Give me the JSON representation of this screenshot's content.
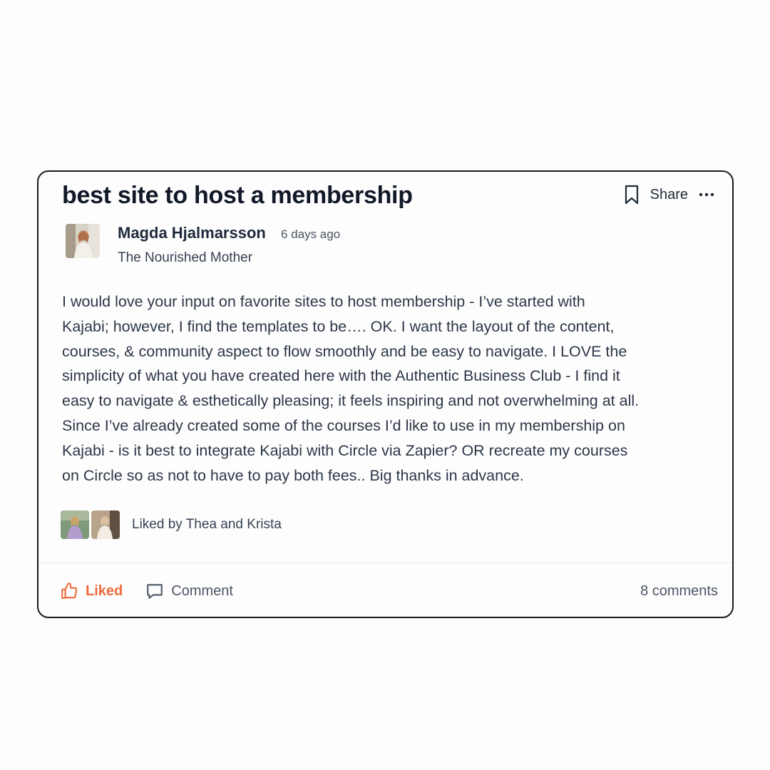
{
  "post": {
    "title": "best site to host a membership",
    "actions": {
      "share_label": "Share",
      "bookmark_icon": "bookmark-icon",
      "more_icon": "more-horizontal-icon"
    },
    "author": {
      "name": "Magda Hjalmarsson",
      "time": "6 days ago",
      "org": "The Nourished Mother"
    },
    "body_lines": [
      "I would love your input on favorite sites to host membership  - I’ve started with",
      "Kajabi; however, I find the templates to be…. OK. I want the layout of the content,",
      "courses, & community aspect to flow smoothly and be easy to navigate. I LOVE the",
      "simplicity of what you have created here with the Authentic Business Club - I find it",
      "easy to navigate & esthetically pleasing; it feels inspiring and not overwhelming at all.",
      "Since I’ve already created some of the courses I’d like to use in my membership on",
      "Kajabi - is it best to integrate Kajabi with Circle via Zapier? OR recreate my courses",
      "on Circle so as not to have to pay both fees.. Big thanks in advance."
    ],
    "likes_text": "Liked by Thea and Krista",
    "footer": {
      "like_label": "Liked",
      "comment_label": "Comment",
      "comment_count": "8 comments"
    },
    "colors": {
      "accent": "#ef6a3b",
      "border": "#1b1b1b",
      "text": "#1f2937"
    }
  }
}
